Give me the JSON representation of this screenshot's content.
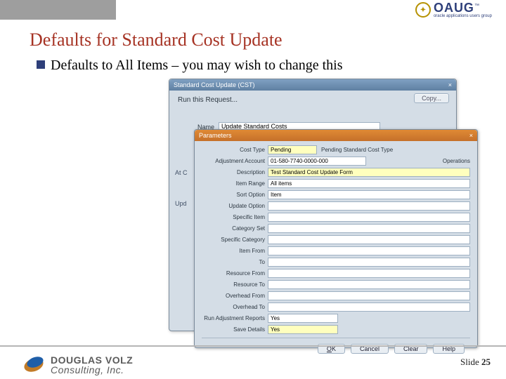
{
  "header": {
    "oaug_brand": "OAUG",
    "oaug_tagline": "oracle applications users group",
    "oaug_tm": "™"
  },
  "title": "Defaults for Standard Cost Update",
  "bullet": "Defaults to All Items – you may wish to change this",
  "outer": {
    "window_title": "Standard Cost Update (CST)",
    "run_label": "Run this Request...",
    "copy_btn": "Copy...",
    "name_label": "Name",
    "name_value": "Update Standard Costs",
    "stub_left_1": "At C",
    "stub_left_2": "Upd"
  },
  "param": {
    "window_title": "Parameters",
    "rows": {
      "cost_type": {
        "label": "Cost Type",
        "value": "Pending",
        "side": "Pending Standard Cost Type"
      },
      "adj_account": {
        "label": "Adjustment Account",
        "value": "01-580-7740-0000-000",
        "trail": "Operations"
      },
      "description": {
        "label": "Description",
        "value": "Test Standard Cost Update Form"
      },
      "item_range": {
        "label": "Item Range",
        "value": "All items"
      },
      "sort_option": {
        "label": "Sort Option",
        "value": "Item"
      },
      "update_option": {
        "label": "Update Option",
        "value": ""
      },
      "specific_item": {
        "label": "Specific Item",
        "value": ""
      },
      "category_set": {
        "label": "Category Set",
        "value": ""
      },
      "specific_category": {
        "label": "Specific Category",
        "value": ""
      },
      "item_from": {
        "label": "Item From",
        "value": ""
      },
      "to1": {
        "label": "To",
        "value": ""
      },
      "resource_from": {
        "label": "Resource From",
        "value": ""
      },
      "resource_to": {
        "label": "Resource To",
        "value": ""
      },
      "overhead_from": {
        "label": "Overhead From",
        "value": ""
      },
      "overhead_to": {
        "label": "Overhead To",
        "value": ""
      },
      "run_adj_reports": {
        "label": "Run Adjustment Reports",
        "value": "Yes"
      },
      "save_details": {
        "label": "Save Details",
        "value": "Yes"
      }
    },
    "buttons": {
      "ok": "OK",
      "cancel": "Cancel",
      "clear": "Clear",
      "help": "Help"
    }
  },
  "footer": {
    "logo_line1": "DOUGLAS VOLZ",
    "logo_line2": "Consulting, Inc.",
    "slide_label": "Slide ",
    "slide_num": "25"
  }
}
